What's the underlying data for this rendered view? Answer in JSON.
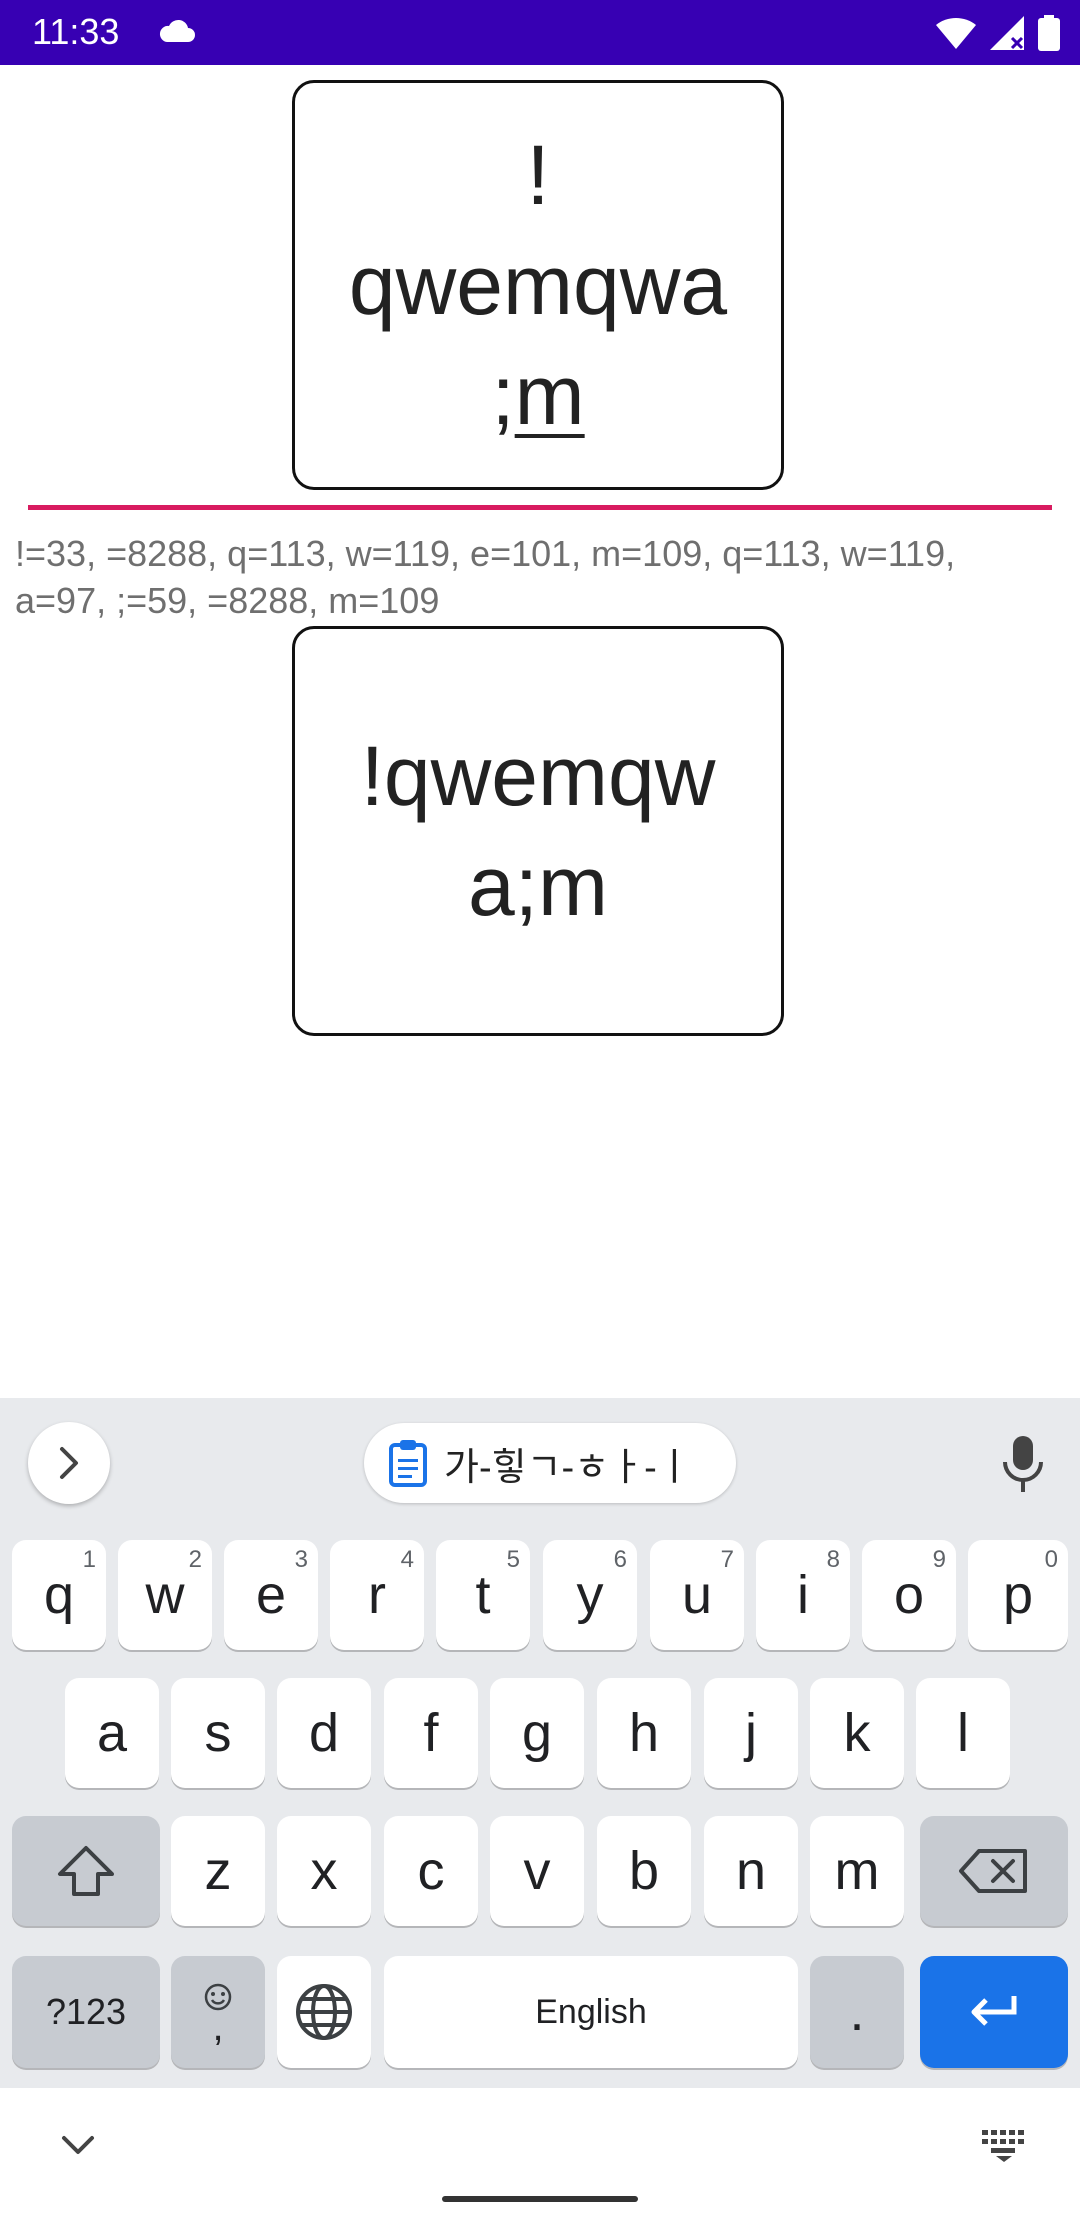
{
  "status_bar": {
    "time": "11:33"
  },
  "editor": {
    "top_box_lines": [
      "!",
      "qwemqwa",
      ";",
      "m"
    ],
    "char_codes": "!=33, =8288, q=113, w=119, e=101, m=109, q=113, w=119, a=97, ;=59, =8288, m=109",
    "bottom_box_lines": [
      "!qwemqw",
      "a;m"
    ],
    "accent_color": "#d81b60"
  },
  "keyboard": {
    "clipboard_chip": "가-힣ㄱ-ㅎㅏ-ㅣ",
    "row1": [
      {
        "k": "q",
        "h": "1"
      },
      {
        "k": "w",
        "h": "2"
      },
      {
        "k": "e",
        "h": "3"
      },
      {
        "k": "r",
        "h": "4"
      },
      {
        "k": "t",
        "h": "5"
      },
      {
        "k": "y",
        "h": "6"
      },
      {
        "k": "u",
        "h": "7"
      },
      {
        "k": "i",
        "h": "8"
      },
      {
        "k": "o",
        "h": "9"
      },
      {
        "k": "p",
        "h": "0"
      }
    ],
    "row2": [
      "a",
      "s",
      "d",
      "f",
      "g",
      "h",
      "j",
      "k",
      "l"
    ],
    "row3": [
      "z",
      "x",
      "c",
      "v",
      "b",
      "n",
      "m"
    ],
    "symbols_label": "?123",
    "emoji_comma_label": ",",
    "space_label": "English",
    "period_label": ".",
    "enter_color": "#1a73e8",
    "icons": [
      "chevron-right-icon",
      "clipboard-icon",
      "mic-icon",
      "shift-icon",
      "backspace-icon",
      "emoji-icon",
      "globe-icon",
      "enter-icon"
    ]
  },
  "status_bar_color": "#3700b3"
}
